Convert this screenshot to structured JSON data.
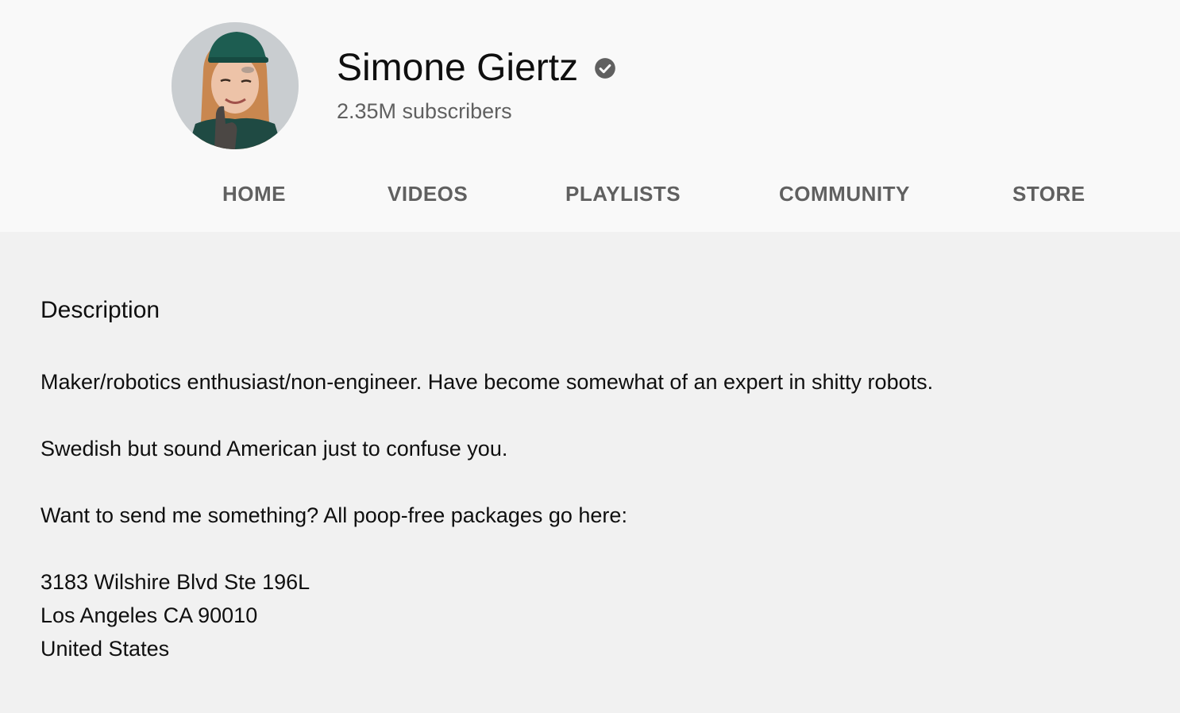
{
  "channel": {
    "name": "Simone Giertz",
    "subscribers": "2.35M subscribers",
    "verified_icon": "verified-check-icon"
  },
  "tabs": [
    {
      "label": "HOME"
    },
    {
      "label": "VIDEOS"
    },
    {
      "label": "PLAYLISTS"
    },
    {
      "label": "COMMUNITY"
    },
    {
      "label": "STORE"
    }
  ],
  "description": {
    "title": "Description",
    "lines": [
      "Maker/robotics enthusiast/non-engineer. Have become somewhat of an expert in shitty robots.",
      "Swedish but sound American just to confuse you.",
      "Want to send me something? All poop-free packages go here:",
      "3183 Wilshire Blvd Ste 196L",
      "Los Angeles CA 90010",
      "United States"
    ]
  },
  "colors": {
    "header_bg": "#f9f9f9",
    "content_bg": "#f1f1f1",
    "tab_text": "#606060",
    "primary_text": "#0f0f0f"
  }
}
